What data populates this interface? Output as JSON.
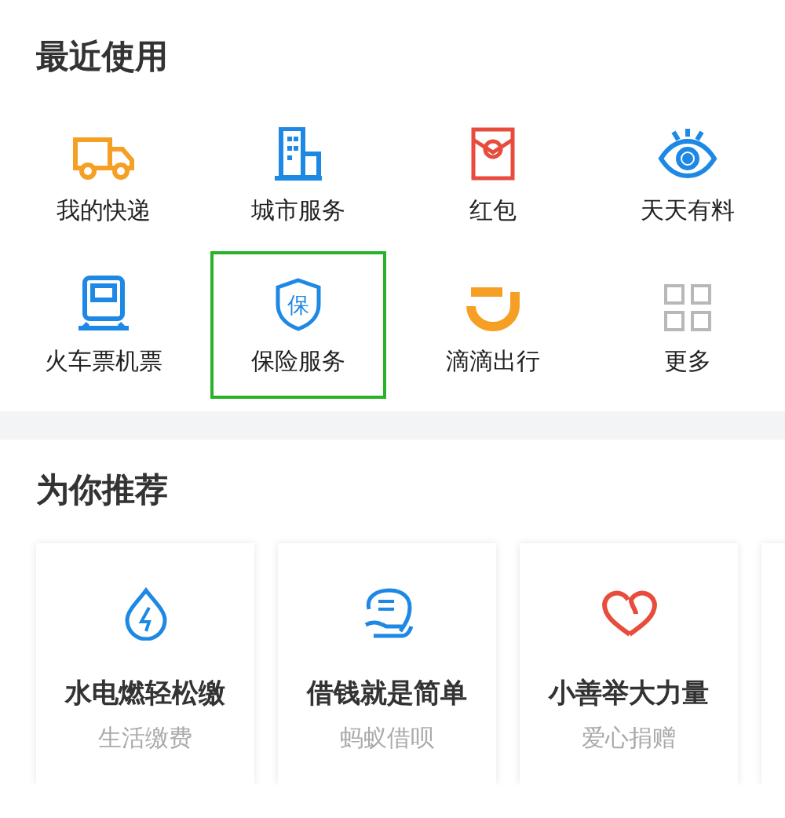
{
  "recent": {
    "title": "最近使用",
    "items": [
      {
        "label": "我的快递",
        "selected": false
      },
      {
        "label": "城市服务",
        "selected": false
      },
      {
        "label": "红包",
        "selected": false
      },
      {
        "label": "天天有料",
        "selected": false
      },
      {
        "label": "火车票机票",
        "selected": false
      },
      {
        "label": "保险服务",
        "selected": true,
        "icon_text": "保"
      },
      {
        "label": "滴滴出行",
        "selected": false
      },
      {
        "label": "更多",
        "selected": false
      }
    ]
  },
  "recommend": {
    "title": "为你推荐",
    "cards": [
      {
        "title": "水电燃轻松缴",
        "subtitle": "生活缴费"
      },
      {
        "title": "借钱就是简单",
        "subtitle": "蚂蚁借呗"
      },
      {
        "title": "小善举大力量",
        "subtitle": "爱心捐赠"
      }
    ]
  }
}
